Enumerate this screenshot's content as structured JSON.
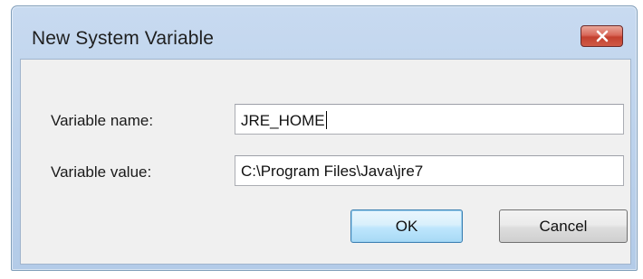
{
  "window": {
    "title": "New System Variable"
  },
  "form": {
    "name_label": "Variable name:",
    "name_value": "JRE_HOME",
    "value_label": "Variable value:",
    "value_value": "C:\\Program Files\\Java\\jre7"
  },
  "buttons": {
    "ok_label": "OK",
    "cancel_label": "Cancel"
  },
  "icons": {
    "close": "close-icon"
  },
  "colors": {
    "title_bar": "#bcd2ec",
    "close_button": "#c94a39",
    "client_background": "#f0f0f0",
    "ok_button": "#bee6fd"
  }
}
